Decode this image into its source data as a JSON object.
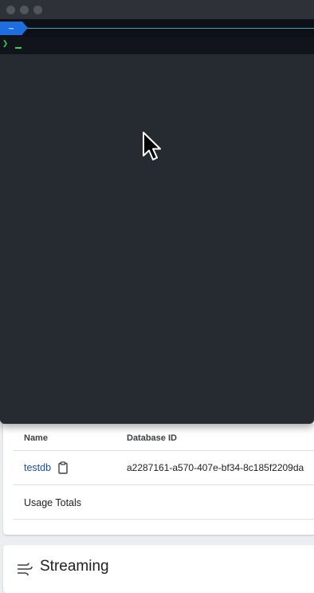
{
  "terminal": {
    "prompt_badge": "~",
    "prompt_symbol": "❯"
  },
  "dashboard": {
    "databases_table": {
      "columns": [
        "Name",
        "Database ID"
      ],
      "rows": [
        {
          "name": "testdb",
          "database_id": "a2287161-a570-407e-bf34-8c185f2209da"
        }
      ],
      "totals_label": "Usage Totals"
    },
    "streaming": {
      "title": "Streaming"
    }
  },
  "colors": {
    "link": "#1a4fa0",
    "prompt_accent": "#1d6fe0",
    "prompt_cursor": "#39d353",
    "terminal_bg": "#282c34"
  }
}
